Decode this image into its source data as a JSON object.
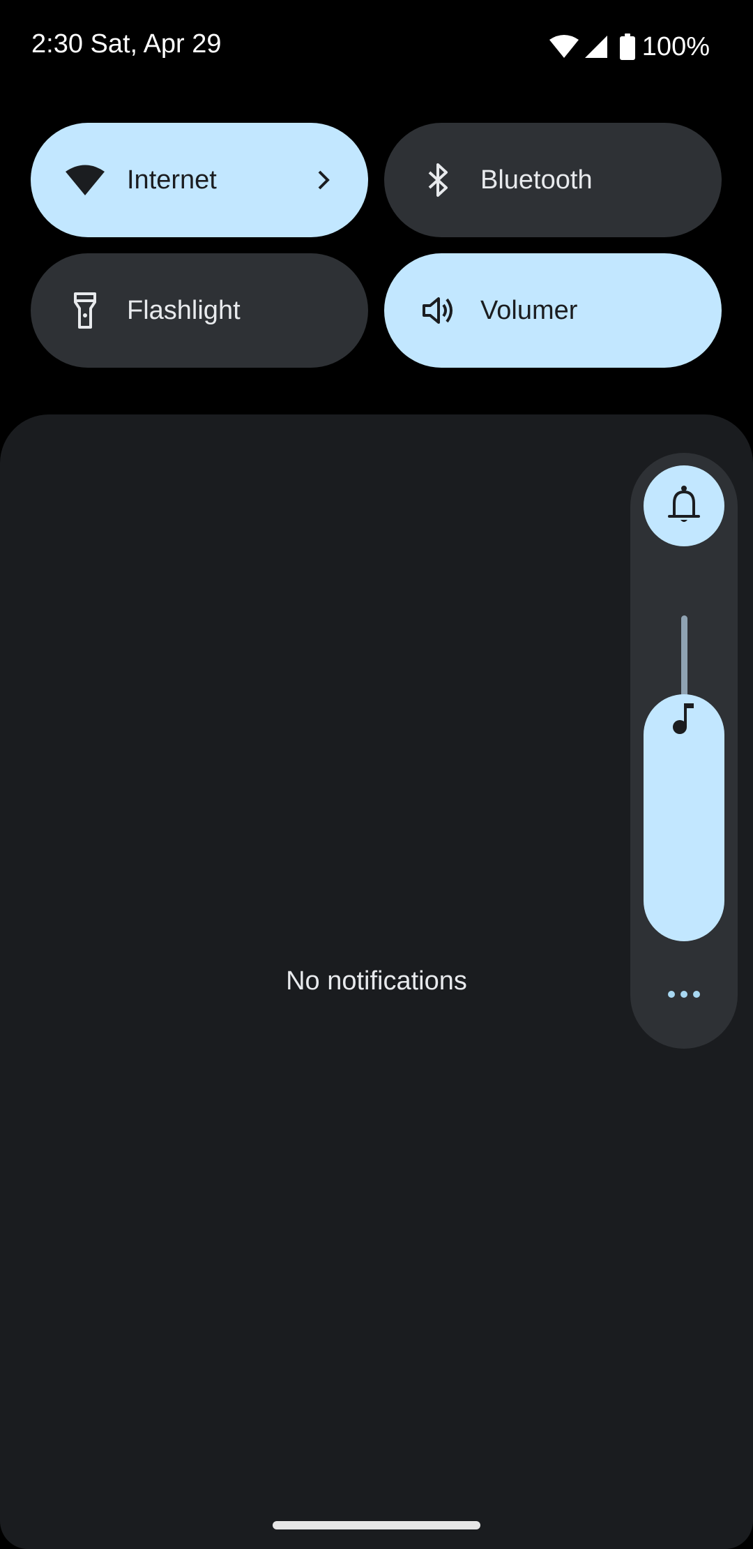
{
  "status_bar": {
    "time_date": "2:30 Sat, Apr 29",
    "battery_percent": "100%",
    "icons": [
      "wifi-icon",
      "cell-signal-icon",
      "battery-icon"
    ]
  },
  "quick_settings": {
    "tiles": [
      {
        "label": "Internet",
        "icon": "wifi-icon",
        "state": "on",
        "has_chevron": true
      },
      {
        "label": "Bluetooth",
        "icon": "bluetooth-icon",
        "state": "off"
      },
      {
        "label": "Flashlight",
        "icon": "flashlight-icon",
        "state": "off"
      },
      {
        "label": "Volumer",
        "icon": "volume-icon",
        "state": "on"
      }
    ]
  },
  "notifications": {
    "empty_text": "No notifications"
  },
  "volume_panel": {
    "ringer_icon": "bell-icon",
    "stream_icon": "music-note-icon",
    "more_icon": "more-dots-icon",
    "media_volume_level": 0.68
  },
  "colors": {
    "tile_on": "#c2e7ff",
    "tile_off": "#2e3135",
    "shade_background": "#1a1c1f",
    "screen_background": "#000000"
  }
}
